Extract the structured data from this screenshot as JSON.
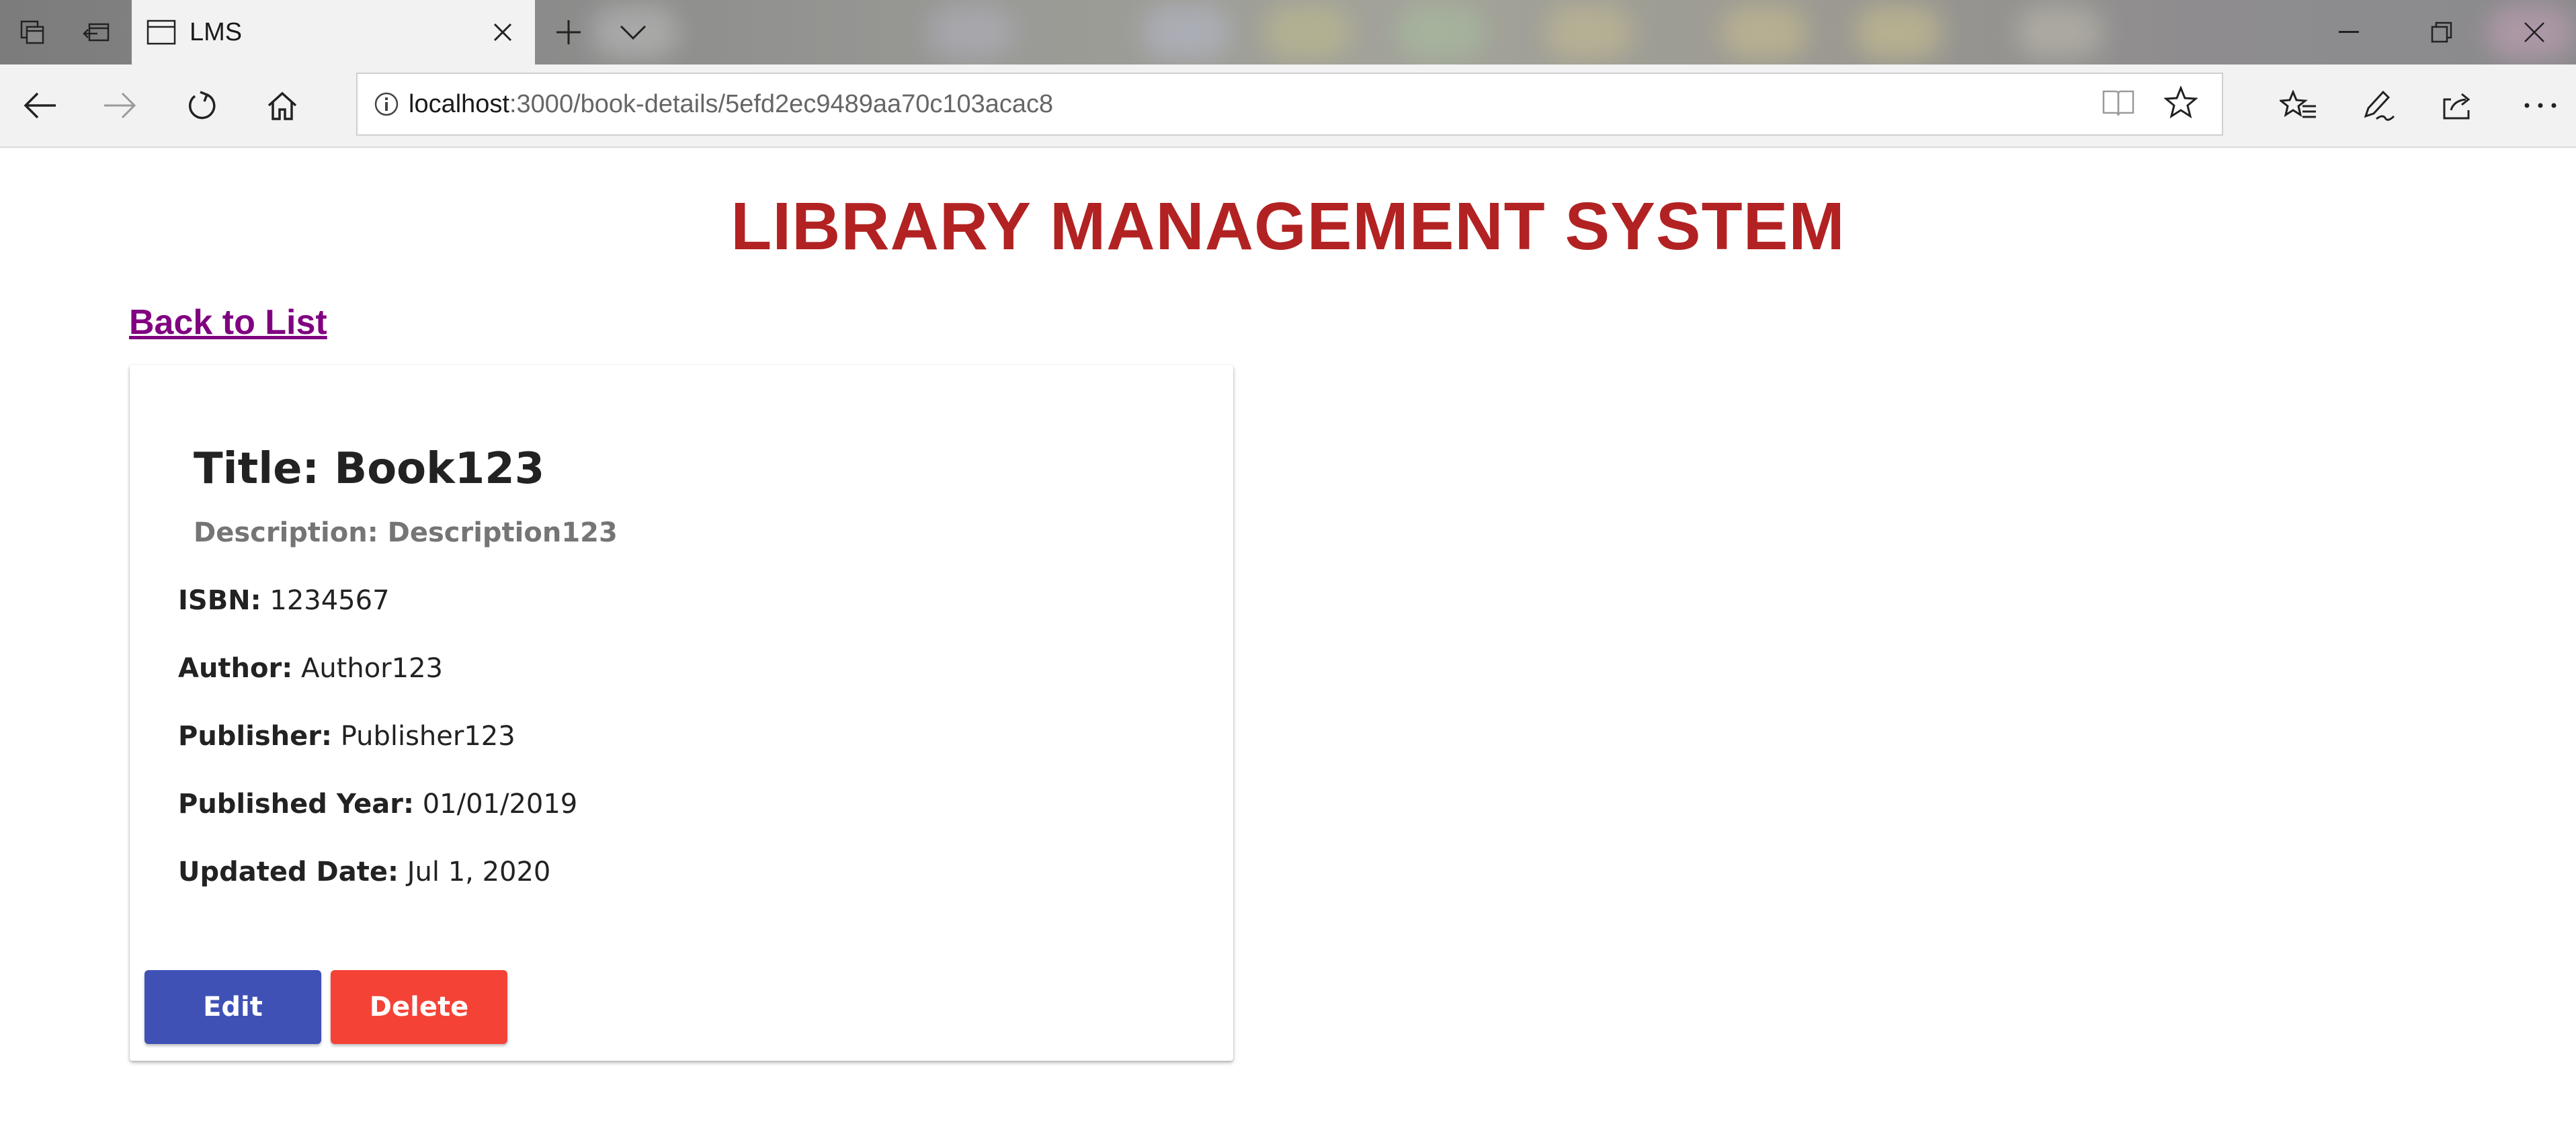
{
  "browser": {
    "tab_title": "LMS",
    "url_host": "localhost",
    "url_path": ":3000/book-details/5efd2ec9489aa70c103acac8",
    "icons": {
      "tab_sets": "tab-sets-icon",
      "tabs_aside": "tabs-aside-icon",
      "page": "page-icon",
      "close": "close-icon",
      "new_tab": "plus-icon",
      "tab_list": "chevron-down-icon",
      "minimize": "minimize-icon",
      "restore": "restore-icon",
      "window_close": "close-icon",
      "back": "back-arrow-icon",
      "forward": "forward-arrow-icon",
      "refresh": "refresh-icon",
      "home": "home-icon",
      "site_info": "info-icon",
      "reading_view": "reading-view-icon",
      "favorite": "star-icon",
      "favorites": "favorites-icon",
      "notes": "pen-icon",
      "share": "share-icon",
      "more": "more-icon"
    }
  },
  "page": {
    "title": "LIBRARY MANAGEMENT SYSTEM",
    "back_link": "Back to List",
    "colors": {
      "title": "#b22222",
      "link": "#800080",
      "edit": "#3f51b5",
      "delete": "#f44336"
    }
  },
  "book": {
    "title": "Title: Book123",
    "description": "Description: Description123",
    "fields": [
      {
        "label": "ISBN:",
        "value": "1234567"
      },
      {
        "label": "Author:",
        "value": "Author123"
      },
      {
        "label": "Publisher:",
        "value": "Publisher123"
      },
      {
        "label": "Published Year:",
        "value": "01/01/2019"
      },
      {
        "label": "Updated Date:",
        "value": "Jul 1, 2020"
      }
    ],
    "edit_label": "Edit",
    "delete_label": "Delete"
  }
}
